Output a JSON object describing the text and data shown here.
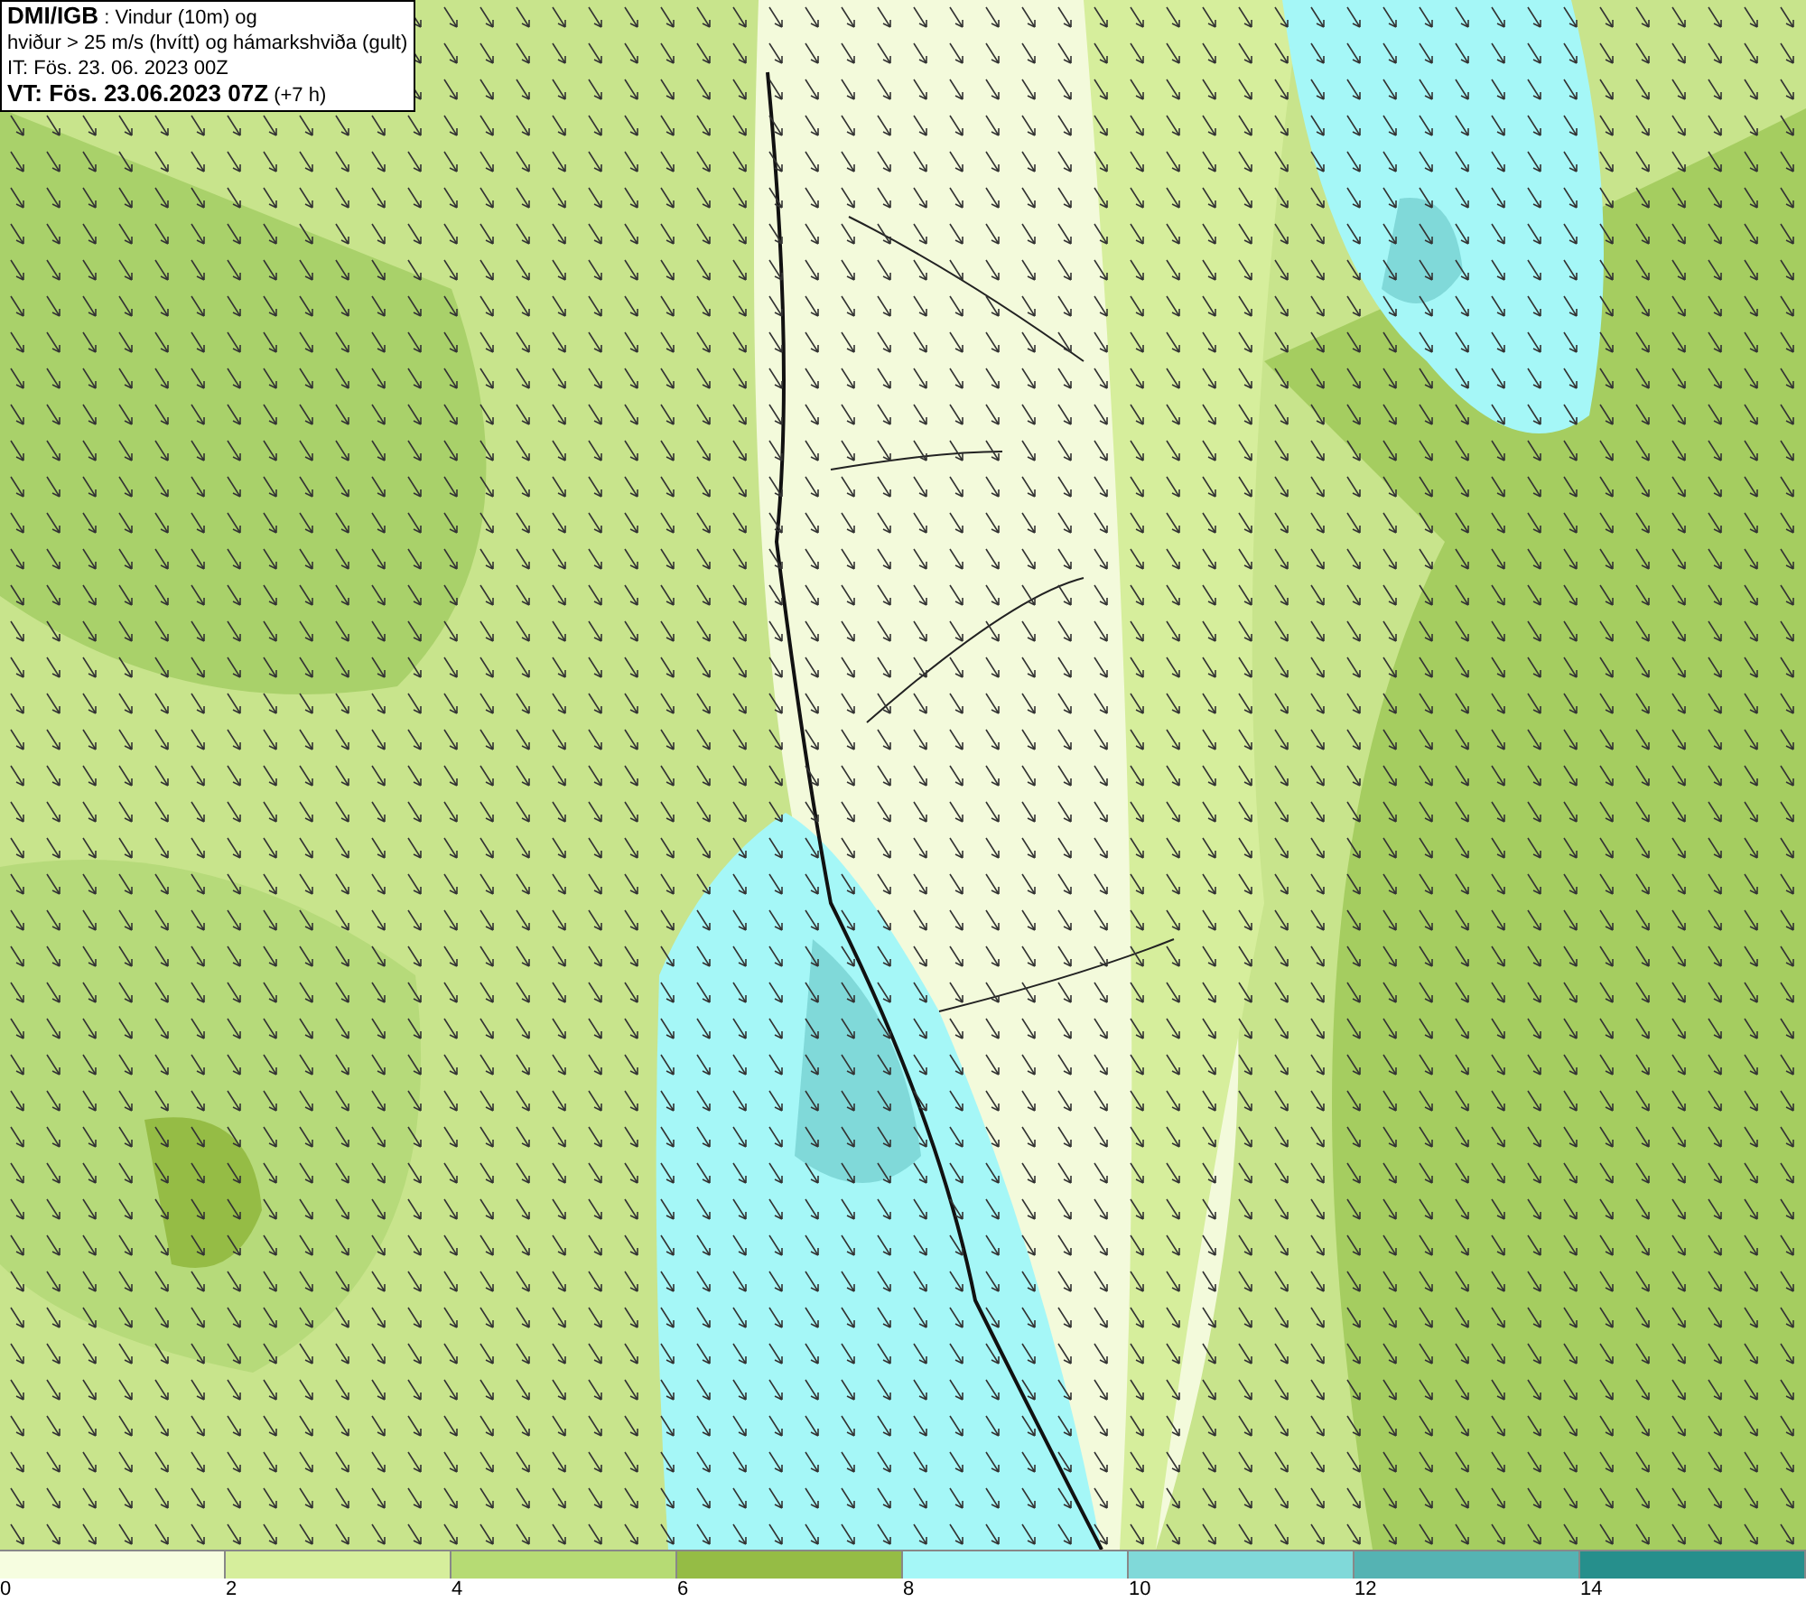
{
  "title_box": {
    "lines": [
      "**DMI/IGB** : Vindur (10m) og",
      "hviður > 25 m/s (hvítt) og hámarkshviða (gult)",
      "IT: Fös. 23. 06. 2023 00Z",
      "**VT: Fös. 23.06.2023 07Z** (+7 h)"
    ]
  },
  "legend": {
    "bins": [
      {
        "color": "#f6fde0"
      },
      {
        "color": "#d6ee9c"
      },
      {
        "color": "#b6db74"
      },
      {
        "color": "#95bc45"
      },
      {
        "color": "#a5f7f7"
      },
      {
        "color": "#80d9d9"
      },
      {
        "color": "#55b3b3"
      },
      {
        "color": "#268f8c"
      }
    ],
    "ticks": [
      "0",
      "2",
      "4",
      "6",
      "8",
      "10",
      "12",
      "14"
    ]
  }
}
